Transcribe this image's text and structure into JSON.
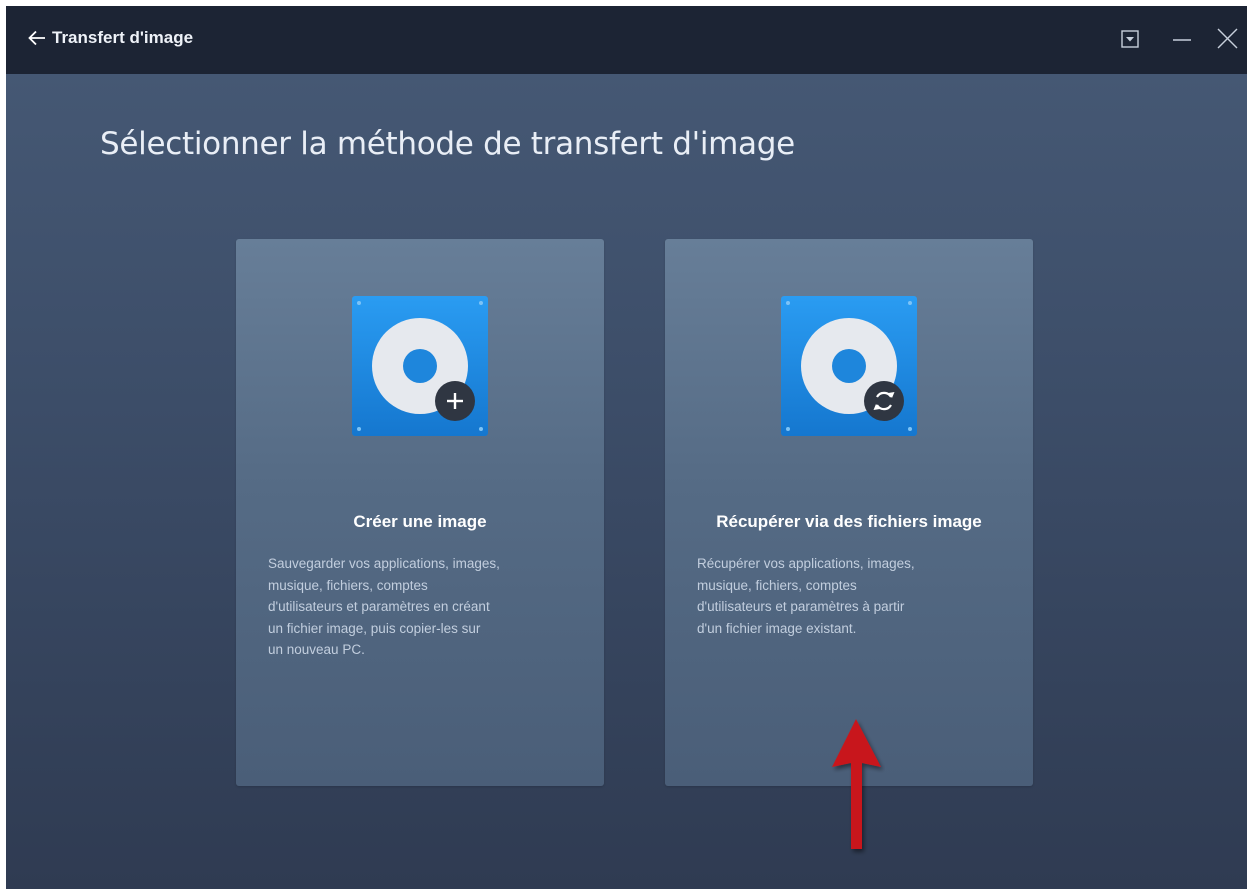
{
  "titlebar": {
    "back_icon": "arrow-left-icon",
    "title": "Transfert d'image",
    "controls": [
      "dropdown-box-icon",
      "minimize-icon",
      "close-icon"
    ]
  },
  "main": {
    "heading": "Sélectionner la méthode de transfert d'image",
    "cards": [
      {
        "icon": "disk-image-plus-icon",
        "title": "Créer une image",
        "description": "Sauvegarder vos applications, images,\nmusique, fichiers, comptes\nd'utilisateurs et paramètres en créant\nun fichier image, puis copier-les sur\nun nouveau PC."
      },
      {
        "icon": "disk-image-restore-icon",
        "title": "Récupérer via des fichiers image",
        "description": "Récupérer vos applications, images,\nmusique, fichiers, comptes\nd'utilisateurs et paramètres à partir\nd'un fichier image existant."
      }
    ]
  },
  "annotation": {
    "icon": "red-arrow-up-icon",
    "color": "#c8181b"
  },
  "colors": {
    "titlebar": "#1c2434",
    "background": "#3f5068",
    "card": "#5b708b",
    "icon_blue": "#1e8fe6"
  }
}
